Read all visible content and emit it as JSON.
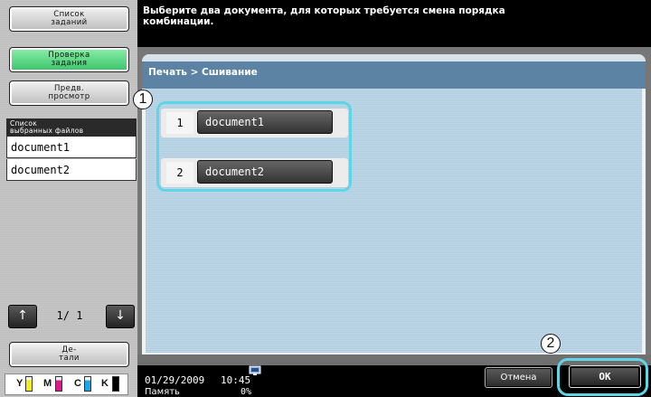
{
  "sidebar": {
    "job_list_label": "Список\nзаданий",
    "check_job_label": "Проверка\nзадания",
    "preview_label": "Предв.\nпросмотр",
    "selected_files_header": "Список\nвыбранных файлов",
    "selected_files": [
      "document1",
      "document2"
    ],
    "page_indicator": "1/  1",
    "up_arrow": "↑",
    "down_arrow": "↓",
    "details_label": "Де-\nтали",
    "toner": [
      "Y",
      "M",
      "C",
      "K"
    ]
  },
  "header": {
    "instruction": "Выберите два документа, для которых требуется смена порядка комбинации."
  },
  "panel": {
    "breadcrumb": "Печать > Сшивание",
    "documents": [
      {
        "number": "1",
        "name": "document1"
      },
      {
        "number": "2",
        "name": "document2"
      }
    ],
    "callouts": [
      "1",
      "2"
    ]
  },
  "status": {
    "date": "01/29/2009",
    "time": "10:45",
    "memory_label": "Память",
    "memory_value": "0%"
  },
  "buttons": {
    "cancel": "Отмена",
    "ok": "OK"
  },
  "colors": {
    "accent_callout": "#5fd6e8",
    "check_job_green": "#39c26a",
    "breadcrumb_bar": "#5d83a4"
  }
}
